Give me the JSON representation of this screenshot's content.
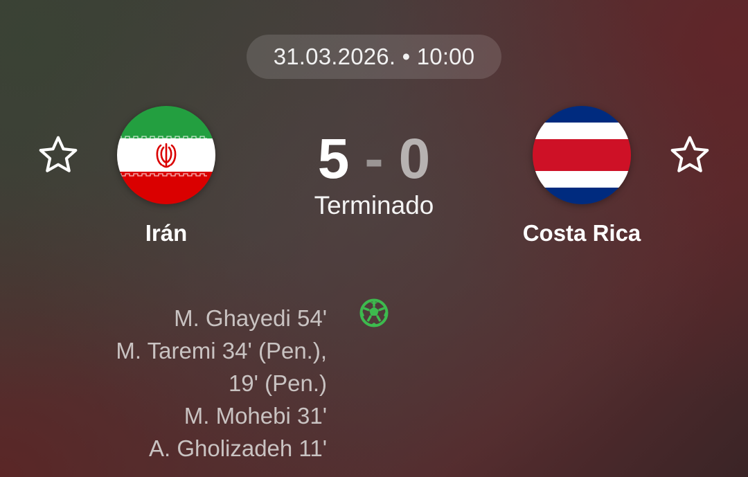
{
  "header": {
    "date_time": "31.03.2026. • 10:00"
  },
  "match": {
    "status": "Terminado",
    "score": {
      "home": "5",
      "separator": "-",
      "away": "0"
    },
    "home_team": {
      "name": "Irán",
      "flag_icon": "iran-flag-icon",
      "flag_colors": [
        "#239f40",
        "#ffffff",
        "#da0000"
      ]
    },
    "away_team": {
      "name": "Costa Rica",
      "flag_icon": "costa-rica-flag-icon",
      "flag_colors": [
        "#002b7f",
        "#ffffff",
        "#ce1126"
      ]
    },
    "goals_icon": "soccer-ball-icon",
    "goal_icon_color": "#3dba4e",
    "home_scorers": [
      "M. Ghayedi 54'",
      "M. Taremi 34' (Pen.),",
      "19' (Pen.)",
      "M. Mohebi 31'",
      "A. Gholizadeh 11'"
    ]
  },
  "favorites": {
    "home_icon": "star-outline-icon",
    "away_icon": "star-outline-icon"
  }
}
